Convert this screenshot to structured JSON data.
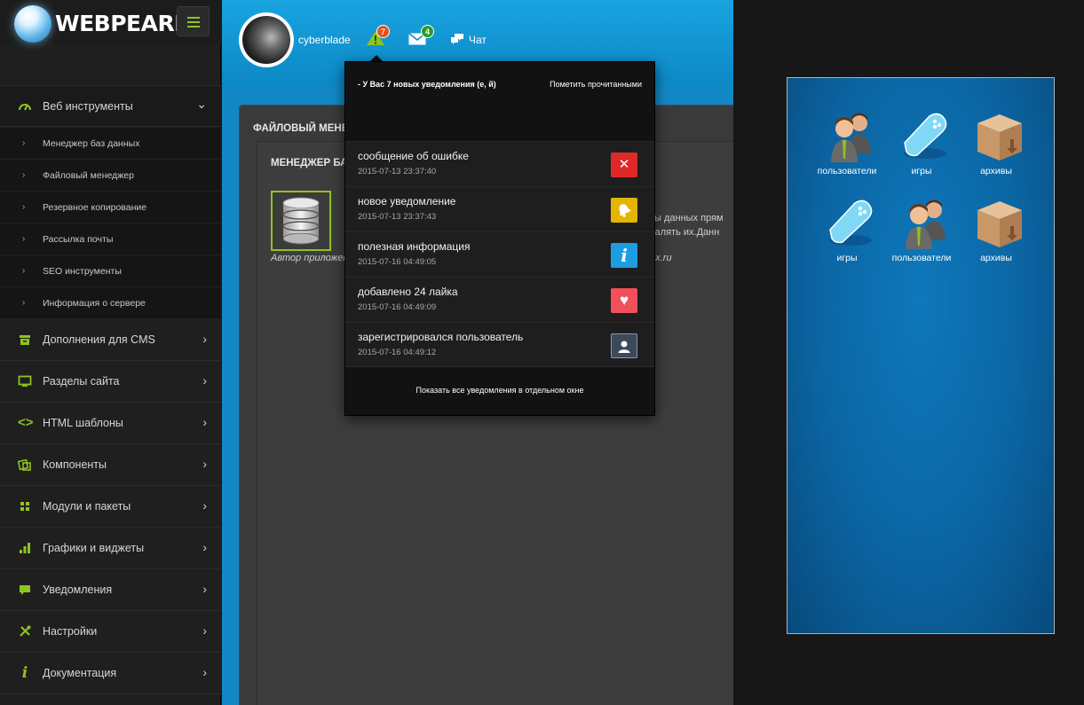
{
  "brand": {
    "name": "WEBPEARL"
  },
  "sidebar": {
    "open_section": {
      "label": "Веб инструменты",
      "icon": "speedometer-icon"
    },
    "sub_items": [
      {
        "label": "Менеджер баз данных"
      },
      {
        "label": "Файловый менеджер"
      },
      {
        "label": "Резервное копирование"
      },
      {
        "label": "Рассылка почты"
      },
      {
        "label": "SEO инструменты"
      },
      {
        "label": "Информация о сервере"
      }
    ],
    "items": [
      {
        "label": "Дополнения для CMS",
        "icon": "archive-icon"
      },
      {
        "label": "Разделы сайта",
        "icon": "monitor-icon"
      },
      {
        "label": "HTML шаблоны",
        "icon": "code-icon"
      },
      {
        "label": "Компоненты",
        "icon": "components-icon"
      },
      {
        "label": "Модули и пакеты",
        "icon": "grid-icon"
      },
      {
        "label": "Графики и виджеты",
        "icon": "bar-chart-icon"
      },
      {
        "label": "Уведомления",
        "icon": "comment-icon"
      },
      {
        "label": "Настройки",
        "icon": "tools-icon"
      },
      {
        "label": "Документация",
        "icon": "info-icon"
      }
    ]
  },
  "topbar": {
    "username": "cyberblade",
    "alerts_count": "7",
    "messages_count": "4",
    "chat_label": "Чат"
  },
  "content": {
    "panel_title": "ФАЙЛОВЫЙ МЕНЕД",
    "inner_title": "МЕНЕДЖЕР БАЗ",
    "author": "Автор приложен",
    "desc_line1": "азы данных прям",
    "desc_line2": "удалять их.Данн",
    "desc_line3": "dex.ru"
  },
  "notifications": {
    "header": "- У Вас 7 новых уведомления (е, й)",
    "mark_read": "Пометить прочитанными",
    "items": [
      {
        "title": "сообщение об ошибке",
        "date": "2015-07-13 23:37:40",
        "icon": "close-icon",
        "color": "#e02828"
      },
      {
        "title": "новое уведомление",
        "date": "2015-07-13 23:37:43",
        "icon": "bell-icon",
        "color": "#e3b400"
      },
      {
        "title": "полезная информация",
        "date": "2015-07-16 04:49:05",
        "icon": "info-icon",
        "color": "#1d9de0"
      },
      {
        "title": "добавлено 24 лайка",
        "date": "2015-07-16 04:49:09",
        "icon": "heart-icon",
        "color": "#f0505a"
      },
      {
        "title": "зарегистрировался пользователь",
        "date": "2015-07-16 04:49:12",
        "icon": "user-icon",
        "color": "#3a4a5a"
      }
    ],
    "footer": "Показать все уведомления в отдельном окне"
  },
  "desktop": {
    "icons": [
      {
        "label": "пользователи",
        "icon": "users-icon"
      },
      {
        "label": "игры",
        "icon": "gamepad-icon"
      },
      {
        "label": "архивы",
        "icon": "box-icon"
      },
      {
        "label": "игры",
        "icon": "gamepad-icon"
      },
      {
        "label": "пользователи",
        "icon": "users-icon"
      },
      {
        "label": "архивы",
        "icon": "box-icon"
      }
    ]
  },
  "colors": {
    "accent": "#8fc31f",
    "topbar": "#0d88c5",
    "sidebar": "#1f1f1f"
  }
}
